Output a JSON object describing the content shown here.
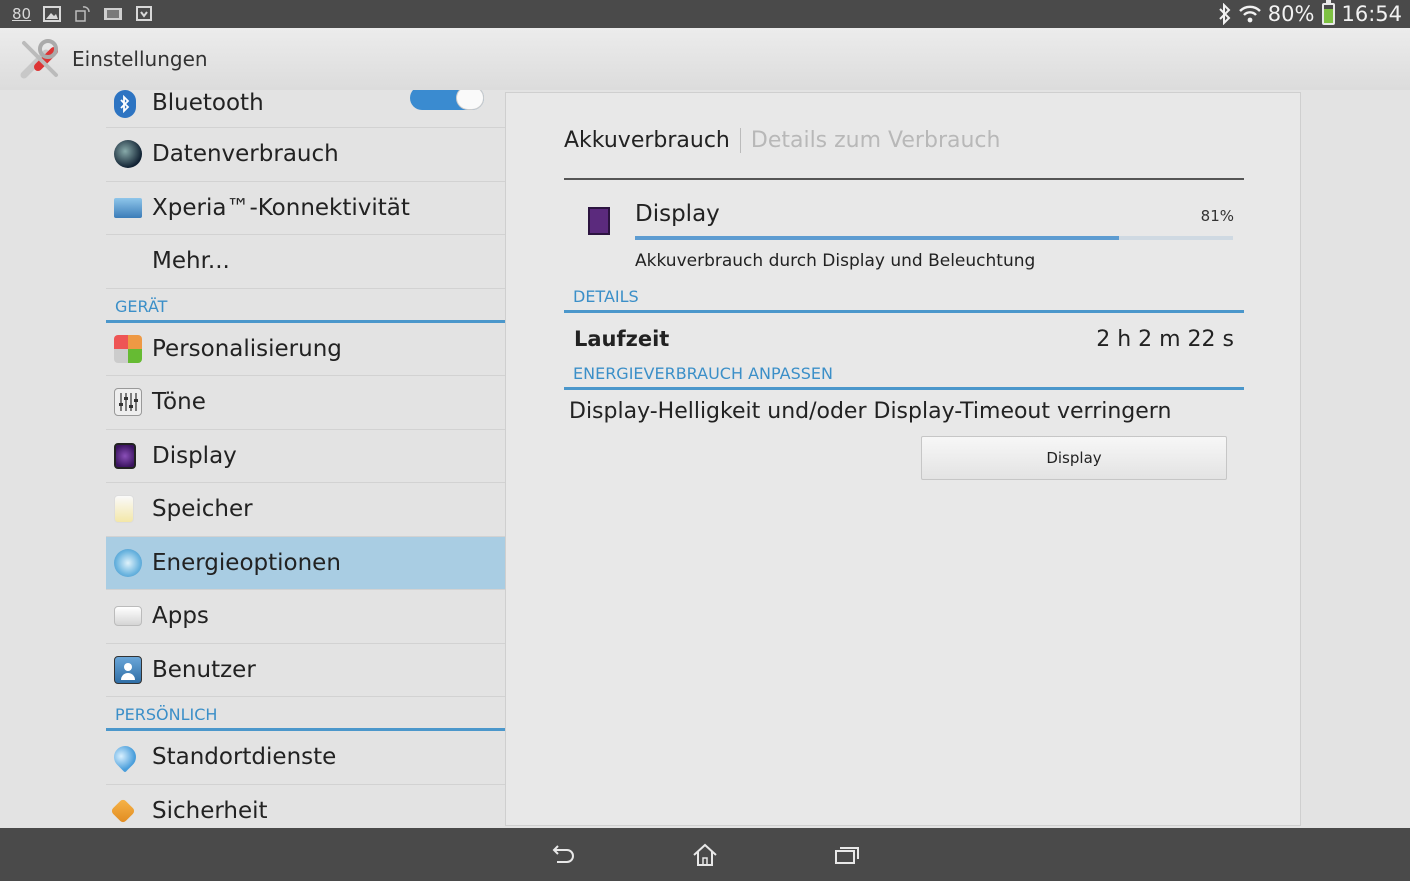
{
  "status_bar": {
    "notification_count": "80",
    "battery_percent": "80%",
    "battery_level": 0.8,
    "time": "16:54",
    "icons": [
      "image-icon",
      "rotation-lock-icon",
      "tablet-icon",
      "download-icon",
      "bluetooth-icon",
      "wifi-icon",
      "battery-icon"
    ]
  },
  "action_bar": {
    "title": "Einstellungen",
    "icon": "tools-icon"
  },
  "sidebar": {
    "items": [
      {
        "label": "Bluetooth",
        "icon": "bluetooth-icon",
        "toggle": true
      },
      {
        "label": "Datenverbrauch",
        "icon": "data-usage-icon"
      },
      {
        "label": "Xperia™-Konnektivität",
        "icon": "connectivity-icon"
      },
      {
        "label": "Mehr..."
      }
    ],
    "section_geraet": "GERÄT",
    "geraet_items": [
      {
        "label": "Personalisierung",
        "icon": "personalization-icon"
      },
      {
        "label": "Töne",
        "icon": "sliders-icon"
      },
      {
        "label": "Display",
        "icon": "display-icon"
      },
      {
        "label": "Speicher",
        "icon": "storage-icon"
      },
      {
        "label": "Energieoptionen",
        "icon": "power-icon",
        "selected": true
      },
      {
        "label": "Apps",
        "icon": "apps-icon"
      },
      {
        "label": "Benutzer",
        "icon": "user-icon"
      }
    ],
    "section_persoenlich": "PERSÖNLICH",
    "persoenlich_items": [
      {
        "label": "Standortdienste",
        "icon": "location-icon"
      },
      {
        "label": "Sicherheit",
        "icon": "security-icon"
      }
    ]
  },
  "detail": {
    "crumb_active": "Akkuverbrauch",
    "crumb_inactive": "Details zum Verbrauch",
    "usage": {
      "name": "Display",
      "percent_label": "81%",
      "percent_value": 0.81,
      "description": "Akkuverbrauch durch Display und Beleuchtung"
    },
    "section_details": "DETAILS",
    "runtime_label": "Laufzeit",
    "runtime_value": "2 h 2 m 22 s",
    "section_energy": "ENERGIEVERBRAUCH ANPASSEN",
    "tip": "Display-Helligkeit und/oder Display-Timeout verringern",
    "button_label": "Display"
  },
  "nav": {
    "icons": [
      "back-icon",
      "home-icon",
      "recent-apps-icon"
    ]
  },
  "colors": {
    "accent": "#4b97cb",
    "selected_bg": "#a9cde3",
    "status_bg": "#4a4a4a"
  }
}
